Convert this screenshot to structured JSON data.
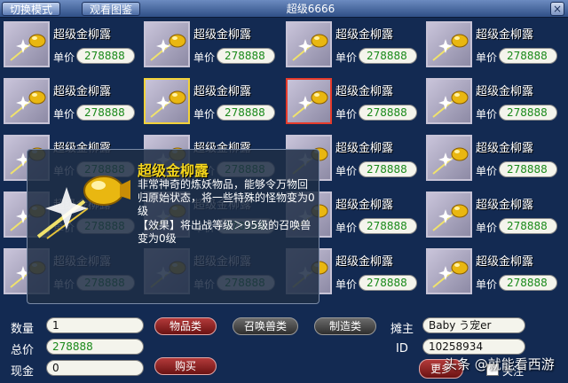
{
  "toolbar": {
    "switch_mode_label": "切换模式",
    "view_gallery_label": "观看图鉴",
    "title": "超级6666",
    "close_label": "×"
  },
  "item": {
    "name": "超级金柳露",
    "price_label": "单价",
    "price": "278888"
  },
  "tooltip": {
    "title": "超级金柳露",
    "description": "非常神奇的炼妖物品，能够令万物回归原始状态，将一些特殊的怪物变为0级",
    "effect": "【效果】将出战等级＞95级的召唤兽变为0级"
  },
  "bottom": {
    "quantity_label": "数量",
    "quantity_value": "1",
    "total_label": "总价",
    "total_value": "278888",
    "cash_label": "现金",
    "cash_value": "0",
    "category_items": "物品类",
    "category_pets": "召唤兽类",
    "category_crafting": "制造类",
    "buy_label": "购买",
    "seller_label": "摊主",
    "seller_value": "Baby う宠er",
    "id_label": "ID",
    "id_value": "10258934",
    "more_label": "更多",
    "follow_label": "关注"
  },
  "watermark": "头条 @就能看西游",
  "colors": {
    "background": "#132a52",
    "price_text": "#1a8a1a",
    "tooltip_title": "#f4d51c",
    "selected_yellow": "#f2d23a",
    "selected_red": "#e53b2b"
  }
}
